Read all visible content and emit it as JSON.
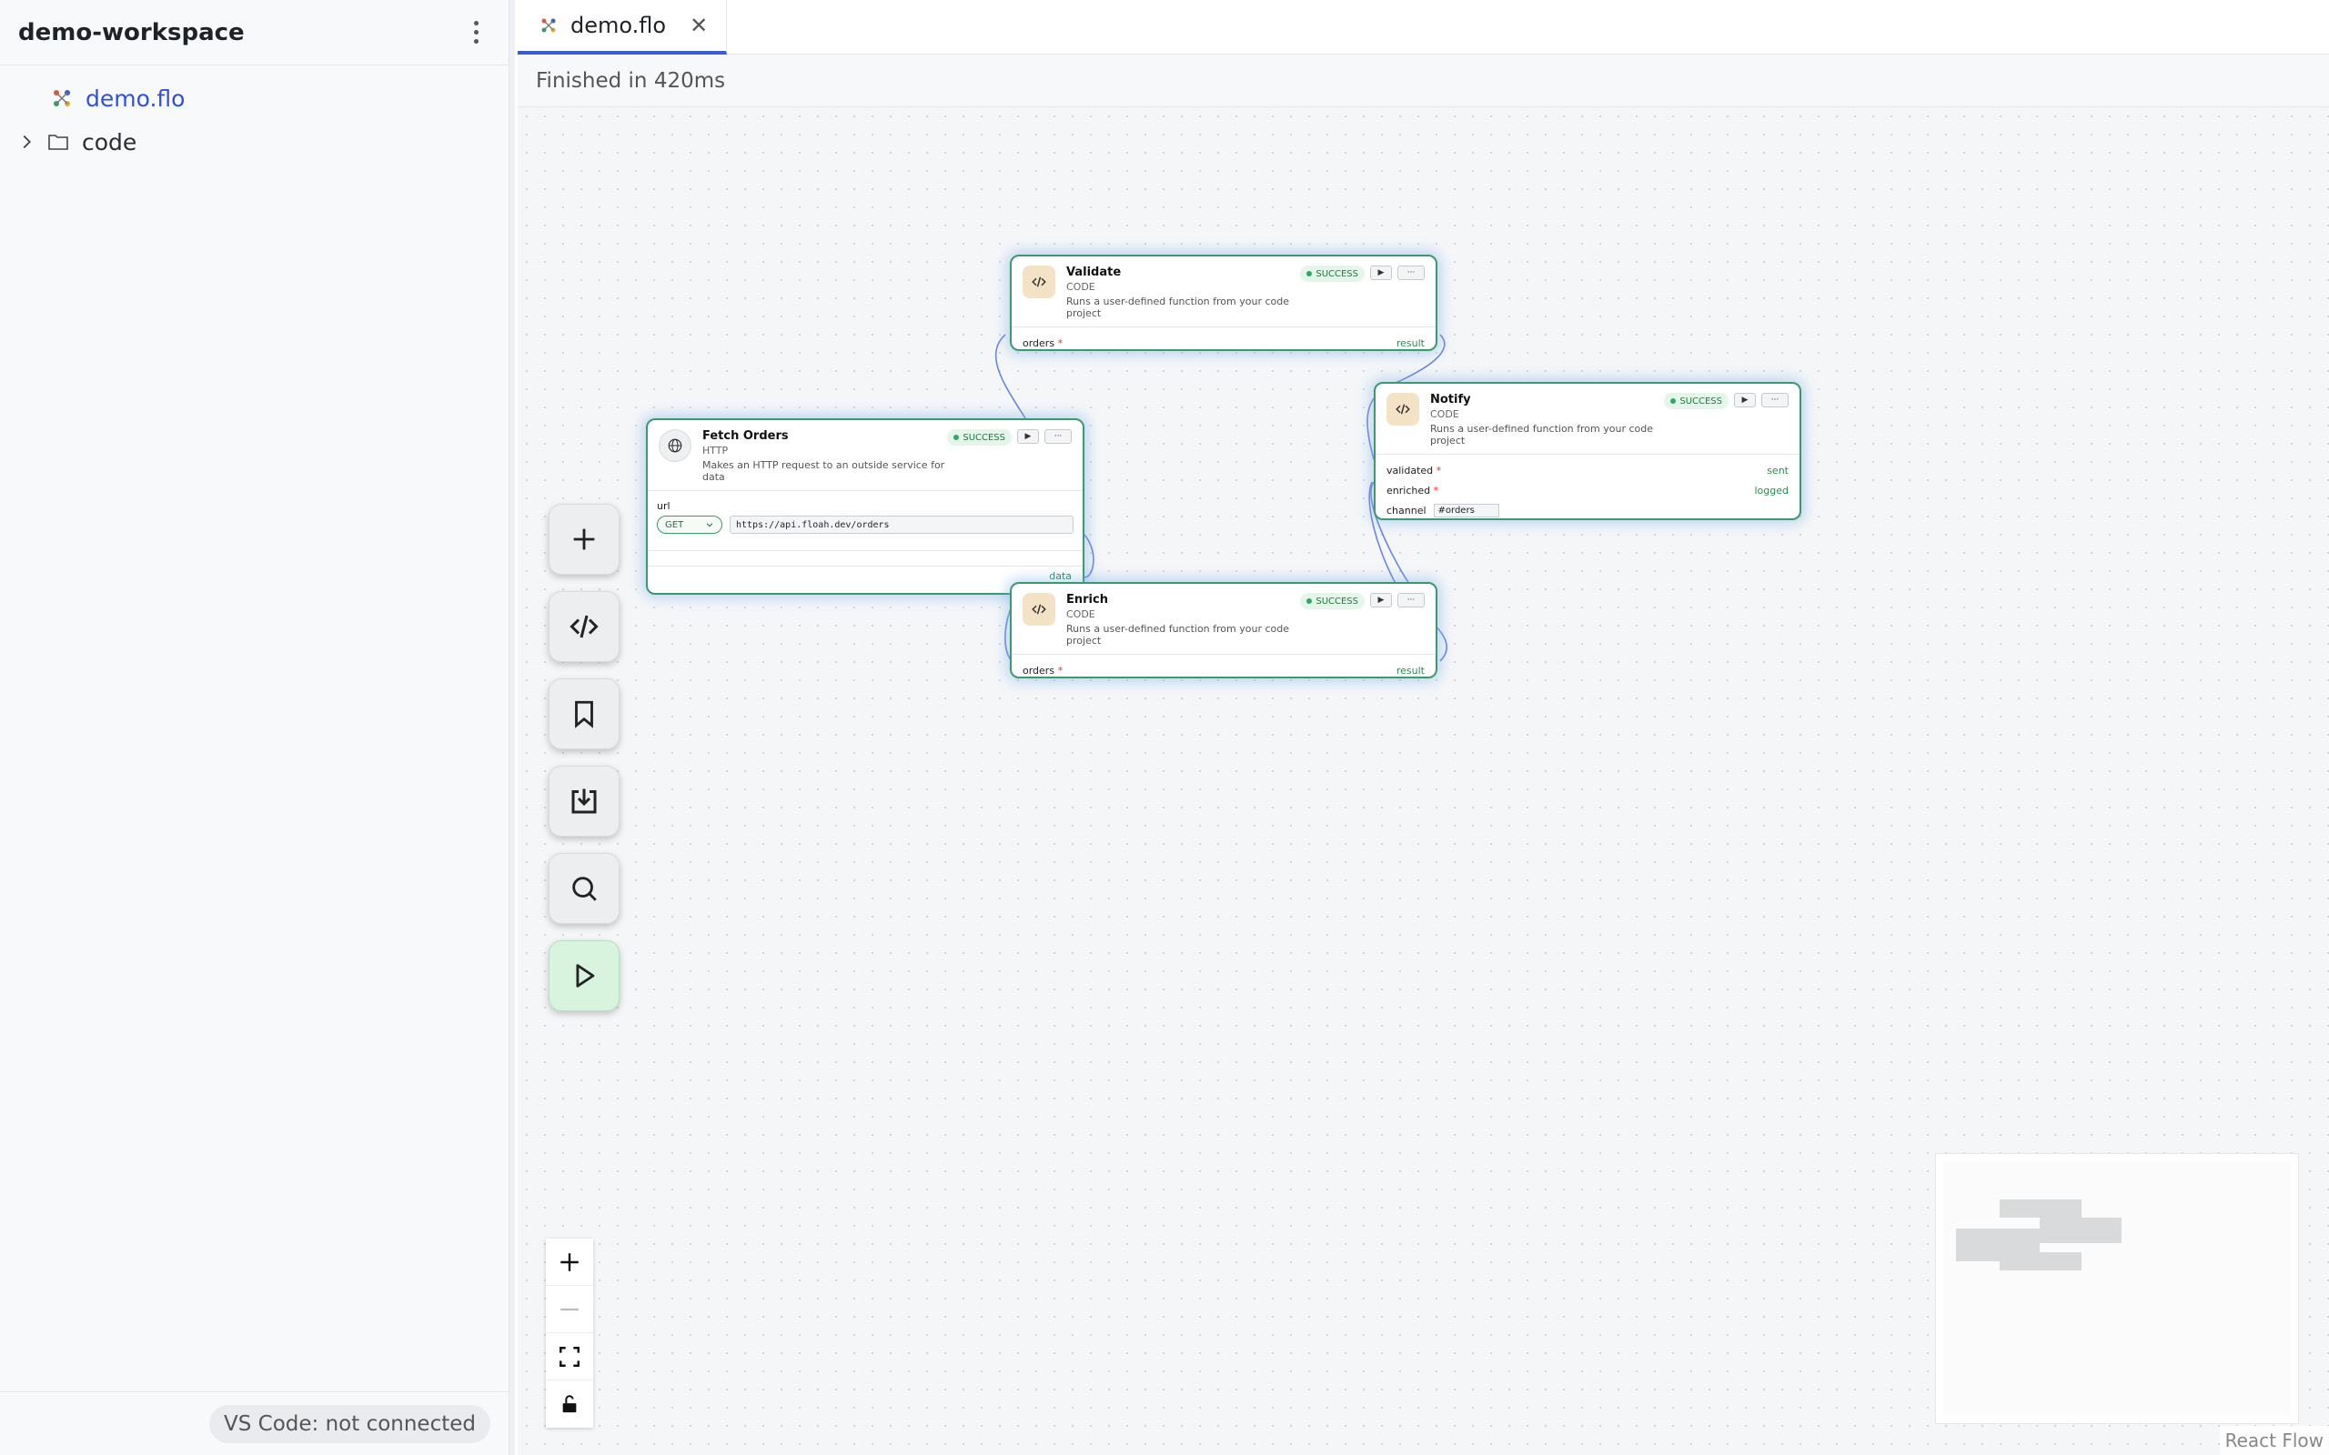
{
  "sidebar": {
    "title": "demo-workspace",
    "items": [
      {
        "label": "demo.flo",
        "kind": "file"
      },
      {
        "label": "code",
        "kind": "folder"
      }
    ],
    "footer_status": "VS Code: not connected"
  },
  "tabs": [
    {
      "label": "demo.flo"
    }
  ],
  "status": "Finished in 420ms",
  "nodes": {
    "validate": {
      "title": "Validate",
      "type": "CODE",
      "desc": "Runs a user-defined function from your code project",
      "status": "SUCCESS",
      "input": "orders",
      "output": "result"
    },
    "fetch": {
      "title": "Fetch Orders",
      "type": "HTTP",
      "desc": "Makes an HTTP request to an outside service for data",
      "status": "SUCCESS",
      "url_label": "url",
      "method": "GET",
      "url": "https://api.floah.dev/orders",
      "output": "data"
    },
    "notify": {
      "title": "Notify",
      "type": "CODE",
      "desc": "Runs a user-defined function from your code project",
      "status": "SUCCESS",
      "input1": "validated",
      "output1": "sent",
      "input2": "enriched",
      "output2": "logged",
      "channel_label": "channel",
      "channel_value": "#orders"
    },
    "enrich": {
      "title": "Enrich",
      "type": "CODE",
      "desc": "Runs a user-defined function from your code project",
      "status": "SUCCESS",
      "input": "orders",
      "output": "result"
    }
  },
  "required_marker": "*",
  "attribution": "React Flow",
  "colors": {
    "accent": "#3a5bd9",
    "success": "#2ea86a",
    "node_border": "#3a9a6a",
    "edge": "#6b86e3"
  }
}
